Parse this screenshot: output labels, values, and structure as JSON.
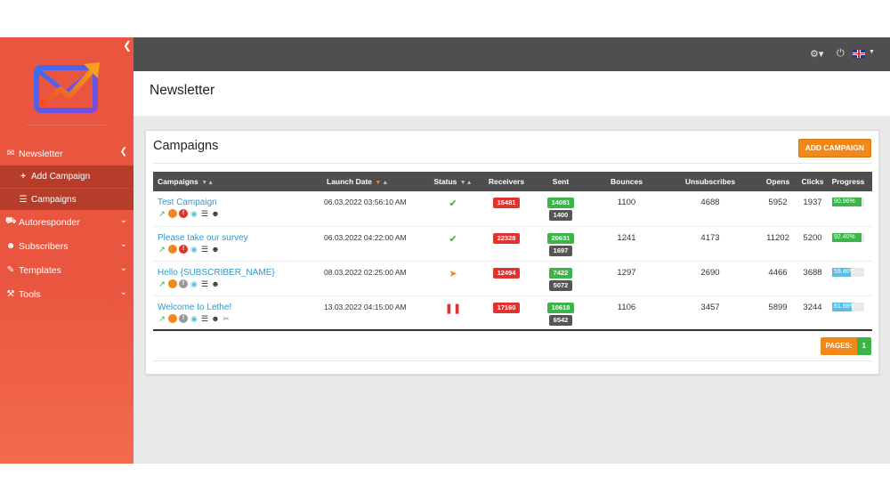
{
  "sidebar": {
    "items": [
      {
        "label": "Newsletter",
        "icon": "envelope-icon"
      },
      {
        "label": "Add Campaign",
        "icon": "plus-icon"
      },
      {
        "label": "Campaigns",
        "icon": "list-icon"
      },
      {
        "label": "Autoresponder",
        "icon": "car-icon"
      },
      {
        "label": "Subscribers",
        "icon": "users-icon"
      },
      {
        "label": "Templates",
        "icon": "paint-roller-icon"
      },
      {
        "label": "Tools",
        "icon": "tools-icon"
      }
    ]
  },
  "header": {
    "title": "Newsletter"
  },
  "card": {
    "title": "Campaigns",
    "add_label": "ADD CAMPAIGN"
  },
  "table": {
    "columns": [
      "Campaigns",
      "Launch Date",
      "Status",
      "Receivers",
      "Sent",
      "Bounces",
      "Unsubscribes",
      "Opens",
      "Clicks",
      "Progress"
    ],
    "rows": [
      {
        "name": "Test Campaign",
        "date": "06.03.2022 03:56:10 AM",
        "status": "completed",
        "receivers": "15481",
        "sent": "14081",
        "sent_failed": "1400",
        "bounces": "1100",
        "unsubscribes": "4688",
        "opens": "5952",
        "clicks": "1937",
        "progress": "90.96%",
        "progress_value": 90.96,
        "progress_color": "green",
        "attachment": false
      },
      {
        "name": "Please take our survey",
        "date": "06.03.2022 04:22:00 AM",
        "status": "completed",
        "receivers": "22328",
        "sent": "20631",
        "sent_failed": "1697",
        "bounces": "1241",
        "unsubscribes": "4173",
        "opens": "11202",
        "clicks": "5200",
        "progress": "92.40%",
        "progress_value": 92.4,
        "progress_color": "green",
        "attachment": false
      },
      {
        "name": "Hello {SUBSCRIBER_NAME}",
        "date": "08.03.2022 02:25:00 AM",
        "status": "sending",
        "receivers": "12494",
        "sent": "7422",
        "sent_failed": "5072",
        "bounces": "1297",
        "unsubscribes": "2690",
        "opens": "4466",
        "clicks": "3688",
        "progress": "59.40%",
        "progress_value": 59.4,
        "progress_color": "blue",
        "attachment": false
      },
      {
        "name": "Welcome to Lethe!",
        "date": "13.03.2022 04:15:00 AM",
        "status": "paused",
        "receivers": "17160",
        "sent": "10618",
        "sent_failed": "6542",
        "bounces": "1106",
        "unsubscribes": "3457",
        "opens": "5899",
        "clicks": "3244",
        "progress": "61.88%",
        "progress_value": 61.88,
        "progress_color": "blue",
        "attachment": true
      }
    ]
  },
  "pager": {
    "label": "PAGES:",
    "current": "1"
  },
  "colors": {
    "accent": "#e9553f",
    "orange": "#f0891a",
    "green": "#3bb44a",
    "link": "#2b9bd3",
    "topbar": "#4f4f4f"
  }
}
